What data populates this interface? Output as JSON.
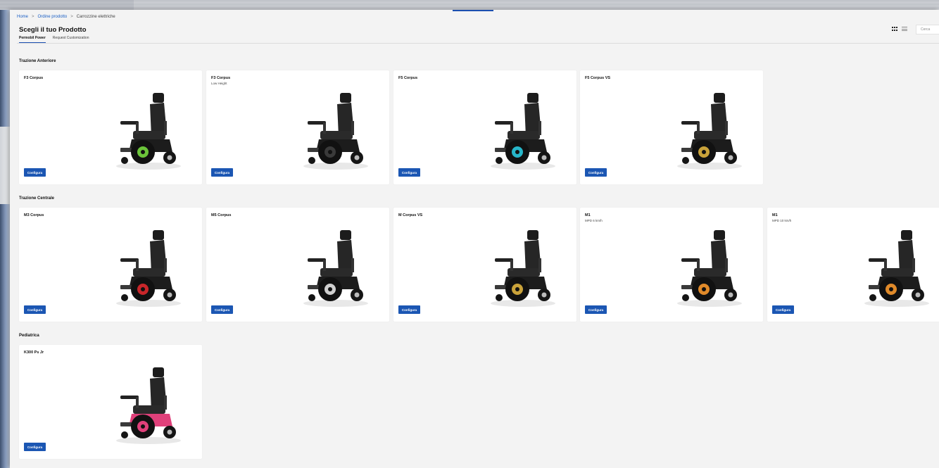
{
  "breadcrumb": {
    "home": "Home",
    "sep": ">",
    "order": "Ordine prodotto",
    "current": "Carrozzine elettriche"
  },
  "page_title": "Scegli il tuo Prodotto",
  "tabs": [
    {
      "label": "Permobil Power",
      "active": true
    },
    {
      "label": "Request Customization",
      "active": false
    }
  ],
  "search": {
    "placeholder": "Cerca"
  },
  "view_icons": [
    "grid-view-icon",
    "list-view-icon"
  ],
  "configure_label": "Configura",
  "colors": {
    "accent": "#1b56b3",
    "link": "#1b5fc4"
  },
  "sections": [
    {
      "title": "Trazione Anteriore",
      "products": [
        {
          "name": "F3 Corpus",
          "subtitle": "",
          "wheel_color": "#6bc43a"
        },
        {
          "name": "F3 Corpus",
          "subtitle": "Low Height",
          "wheel_color": "#3a3a3a"
        },
        {
          "name": "F5 Corpus",
          "subtitle": "",
          "wheel_color": "#27b6c9"
        },
        {
          "name": "F5 Corpus VS",
          "subtitle": "",
          "wheel_color": "#c9a23a"
        }
      ]
    },
    {
      "title": "Trazione Centrale",
      "products": [
        {
          "name": "M3 Corpus",
          "subtitle": "",
          "wheel_color": "#c8262a"
        },
        {
          "name": "M5 Corpus",
          "subtitle": "",
          "wheel_color": "#cfcfcf"
        },
        {
          "name": "M Corpus VS",
          "subtitle": "",
          "wheel_color": "#c9a23a"
        },
        {
          "name": "M1",
          "subtitle": "MPD 6 km/h",
          "wheel_color": "#e08a2a"
        },
        {
          "name": "M1",
          "subtitle": "MPD 10 km/h",
          "wheel_color": "#e08a2a"
        }
      ]
    },
    {
      "title": "Pediatrica",
      "products": [
        {
          "name": "K300 Ps Jr",
          "subtitle": "",
          "wheel_color": "#e0407a"
        }
      ]
    }
  ]
}
